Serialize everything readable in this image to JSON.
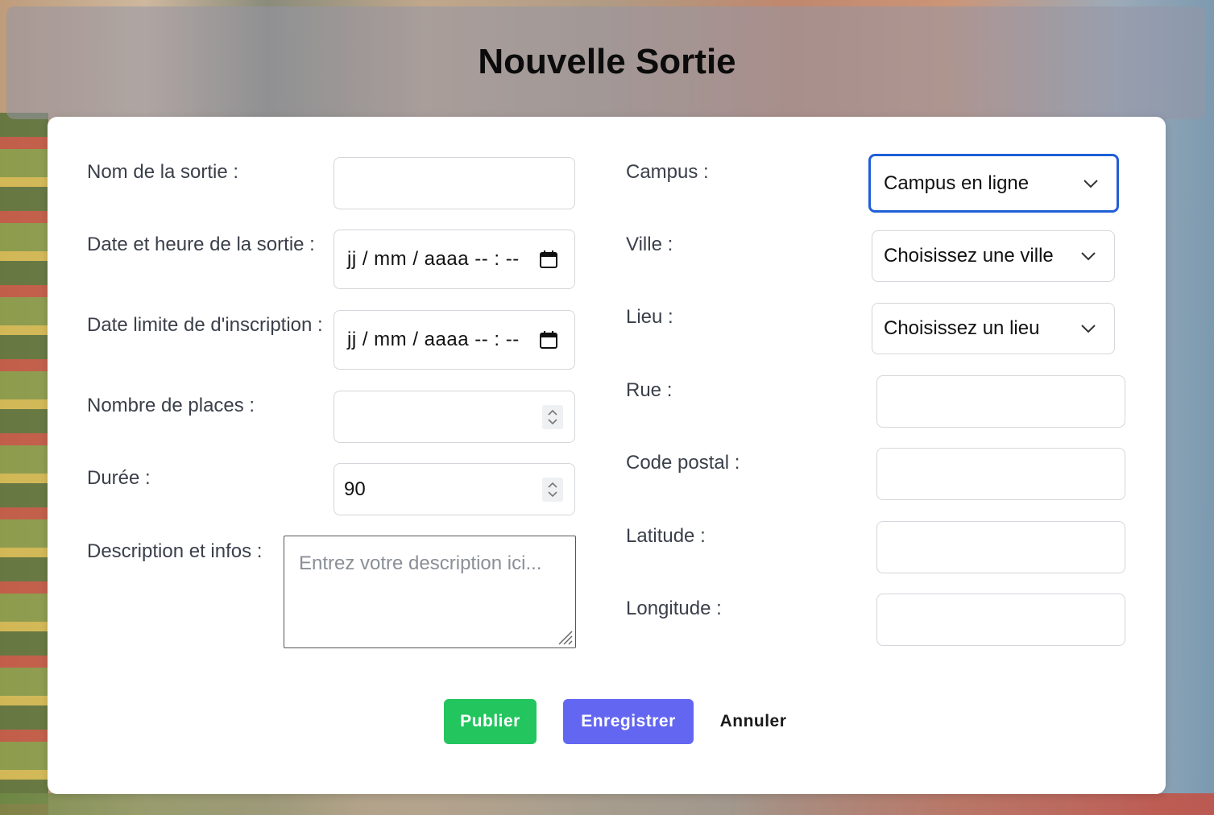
{
  "title": "Nouvelle Sortie",
  "left": {
    "nom_label": "Nom de la sortie :",
    "nom_value": "",
    "date_sortie_label": "Date et heure de la sortie :",
    "date_sortie_value": "jj / mm / aaaa   -- : --",
    "date_limite_label": "Date limite de d'inscription :",
    "date_limite_value": "jj / mm / aaaa   -- : --",
    "places_label": "Nombre de places :",
    "places_value": "",
    "duree_label": "Durée :",
    "duree_value": "90",
    "description_label": "Description et infos :",
    "description_placeholder": "Entrez votre description ici..."
  },
  "right": {
    "campus_label": "Campus :",
    "campus_value": "Campus en ligne",
    "ville_label": "Ville :",
    "ville_value": "Choisissez une ville",
    "lieu_label": "Lieu :",
    "lieu_value": "Choisissez un lieu",
    "rue_label": "Rue :",
    "code_postal_label": "Code postal :",
    "latitude_label": "Latitude :",
    "longitude_label": "Longitude :"
  },
  "buttons": {
    "publish": "Publier",
    "save": "Enregistrer",
    "cancel": "Annuler"
  },
  "colors": {
    "publish": "#22c55e",
    "save": "#6366f1",
    "focus": "#1f5fd6"
  },
  "icons": [
    "calendar-icon",
    "spinner-arrows-icon",
    "chevron-down-icon",
    "resize-handle-icon"
  ]
}
